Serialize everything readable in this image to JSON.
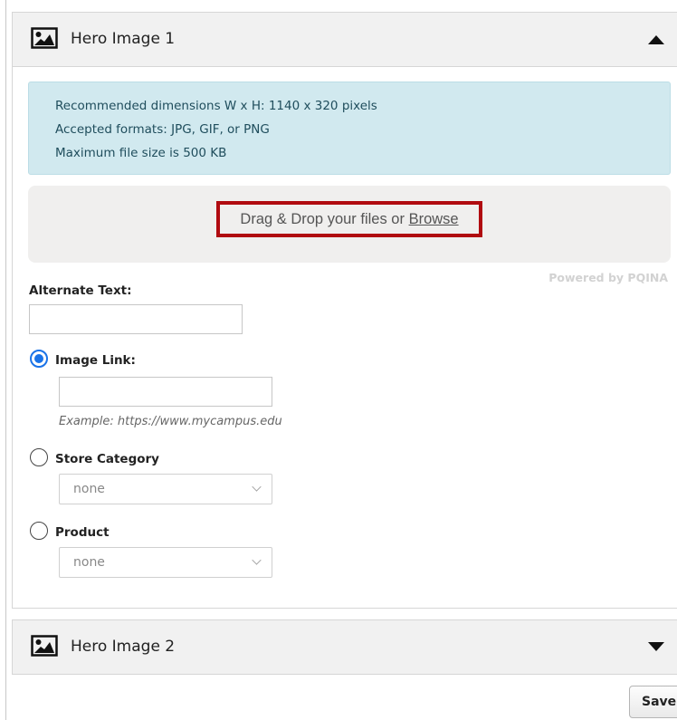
{
  "panels": [
    {
      "title": "Hero Image 1",
      "expanded": true,
      "icon": "image-icon"
    },
    {
      "title": "Hero Image 2",
      "expanded": false,
      "icon": "image-icon"
    }
  ],
  "info": {
    "dimensions": "Recommended dimensions W x H: 1140 x 320 pixels",
    "formats": "Accepted formats: JPG, GIF, or PNG",
    "max_size": "Maximum file size is 500 KB"
  },
  "dropzone": {
    "text": "Drag & Drop your files or ",
    "browse": "Browse",
    "powered_by": "Powered by PQINA",
    "highlight_color": "#b00b10"
  },
  "alt_text": {
    "label": "Alternate Text:",
    "value": ""
  },
  "link_options": {
    "image_link": {
      "label": "Image Link:",
      "selected": true,
      "value": "",
      "example": "Example: https://www.mycampus.edu"
    },
    "store_category": {
      "label": "Store Category",
      "selected": false,
      "value": "none"
    },
    "product": {
      "label": "Product",
      "selected": false,
      "value": "none"
    }
  },
  "actions": {
    "save_label": "Save"
  },
  "colors": {
    "info_bg": "#d1e9ef",
    "info_text": "#1f4d5c",
    "radio_accent": "#1a73e8"
  }
}
